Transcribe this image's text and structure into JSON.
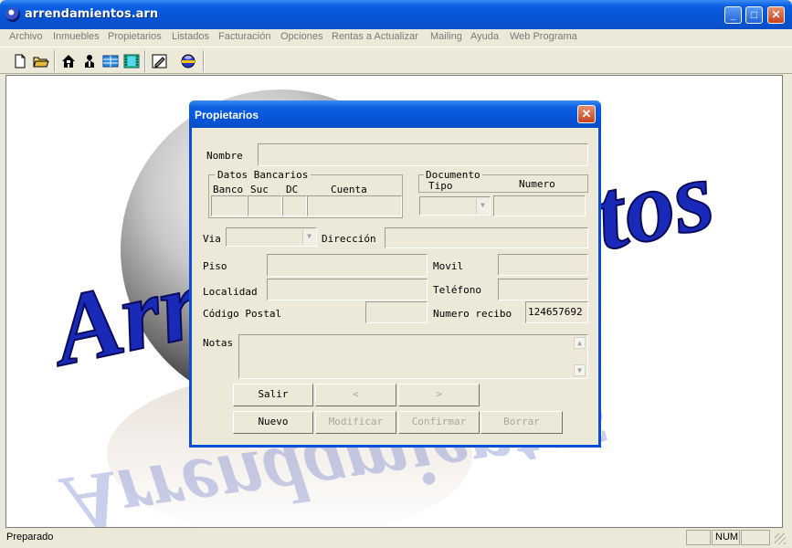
{
  "window": {
    "title": "arrendamientos.arn"
  },
  "menu": [
    "Archivo",
    "Inmuebles",
    "Propietarios",
    "Listados",
    "Facturación",
    "Opciones",
    "Rentas a Actualizar",
    "Mailing",
    "Ayuda",
    "Web Programa"
  ],
  "toolbar": {
    "icons": [
      "new-document-icon",
      "open-folder-icon",
      "house-icon",
      "person-icon",
      "table-icon",
      "film-strip-icon",
      "edit-icon",
      "globe-icon"
    ]
  },
  "background": {
    "logo_text": "Arrendamientos"
  },
  "status": {
    "text": "Preparado",
    "num": "NUM"
  },
  "dialog": {
    "title": "Propietarios",
    "labels": {
      "nombre": "Nombre",
      "datos_bancarios": "Datos Bancarios",
      "banco": "Banco",
      "suc": "Suc",
      "dc": "DC",
      "cuenta": "Cuenta",
      "documento": "Documento",
      "tipo": "Tipo",
      "numero": "Numero",
      "via": "Via",
      "direccion": "Dirección",
      "piso": "Piso",
      "movil": "Movil",
      "localidad": "Localidad",
      "telefono": "Teléfono",
      "codigo_postal": "Código Postal",
      "numero_recibo": "Numero recibo",
      "notas": "Notas"
    },
    "values": {
      "numero_recibo": "124657692"
    },
    "buttons": {
      "salir": "Salir",
      "prev": "<",
      "next": ">",
      "nuevo": "Nuevo",
      "modificar": "Modificar",
      "confirmar": "Confirmar",
      "borrar": "Borrar"
    }
  }
}
